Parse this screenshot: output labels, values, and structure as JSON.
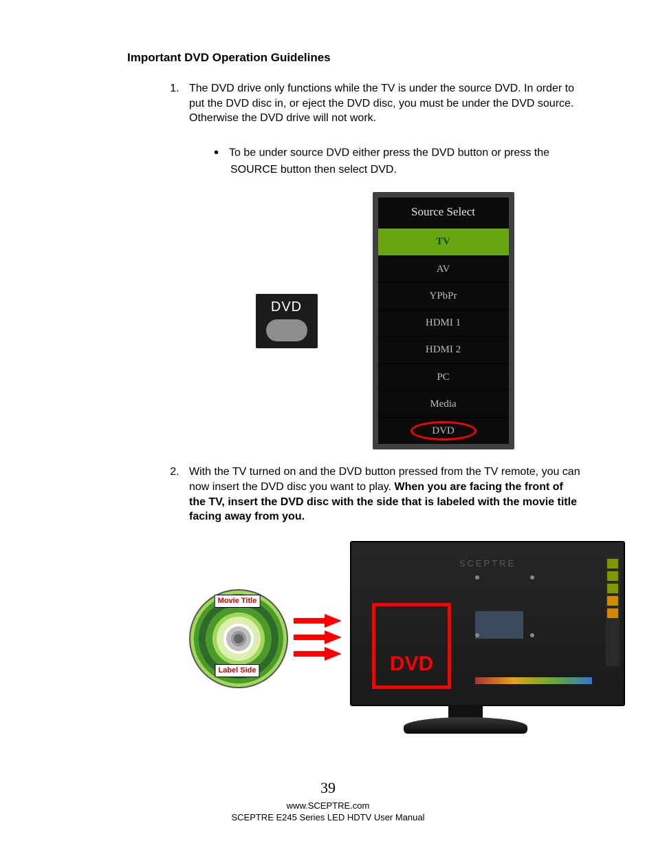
{
  "page": {
    "section_title": "Important DVD Operation Guidelines",
    "list": [
      {
        "text": "The DVD drive only functions while the TV is under the source DVD.  In order to put the DVD disc in, or eject the DVD disc, you must be under the DVD source. Otherwise the DVD drive will not work.",
        "sub": "To be under source DVD either press the DVD button or press the SOURCE button then select DVD."
      },
      {
        "text_pre": "With the TV turned on and the DVD button pressed from the TV remote, you can now insert the DVD disc you want to play.  ",
        "text_bold": "When you are facing the front of the TV, insert the DVD disc with the side that is labeled with the movie title facing away from you."
      }
    ]
  },
  "dvd_button": {
    "label": "DVD"
  },
  "source_menu": {
    "title": "Source Select",
    "items": [
      {
        "label": "TV",
        "selected": true,
        "circled": false
      },
      {
        "label": "AV",
        "selected": false,
        "circled": false
      },
      {
        "label": "YPbPr",
        "selected": false,
        "circled": false
      },
      {
        "label": "HDMI 1",
        "selected": false,
        "circled": false
      },
      {
        "label": "HDMI 2",
        "selected": false,
        "circled": false
      },
      {
        "label": "PC",
        "selected": false,
        "circled": false
      },
      {
        "label": "Media",
        "selected": false,
        "circled": false
      },
      {
        "label": "DVD",
        "selected": false,
        "circled": true
      }
    ]
  },
  "disc": {
    "top_label": "Movie Title",
    "bottom_label": "Label Side"
  },
  "tv_back": {
    "brand": "SCEPTRE",
    "slot_label": "DVD"
  },
  "footer": {
    "page_number": "39",
    "url": "www.SCEPTRE.com",
    "manual": "SCEPTRE E245 Series LED HDTV User Manual"
  }
}
